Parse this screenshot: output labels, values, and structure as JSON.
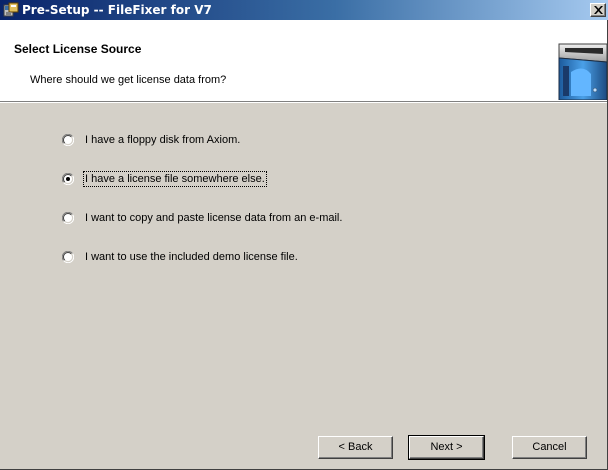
{
  "window": {
    "title": "Pre-Setup -- FileFixer for V7"
  },
  "header": {
    "title": "Select License Source",
    "subtitle": "Where should we get license data from?"
  },
  "options": [
    {
      "label": "I have a floppy disk from Axiom.",
      "selected": false
    },
    {
      "label": "I have a license file somewhere else.",
      "selected": true
    },
    {
      "label": "I want to copy and paste license data from an e-mail.",
      "selected": false
    },
    {
      "label": "I want to use the included demo license file.",
      "selected": false
    }
  ],
  "buttons": {
    "back": "< Back",
    "next": "Next >",
    "cancel": "Cancel"
  },
  "colors": {
    "titlebar_start": "#0a246a",
    "titlebar_end": "#a6caf0",
    "window_face": "#d4d0c8",
    "header_bg": "#ffffff"
  }
}
